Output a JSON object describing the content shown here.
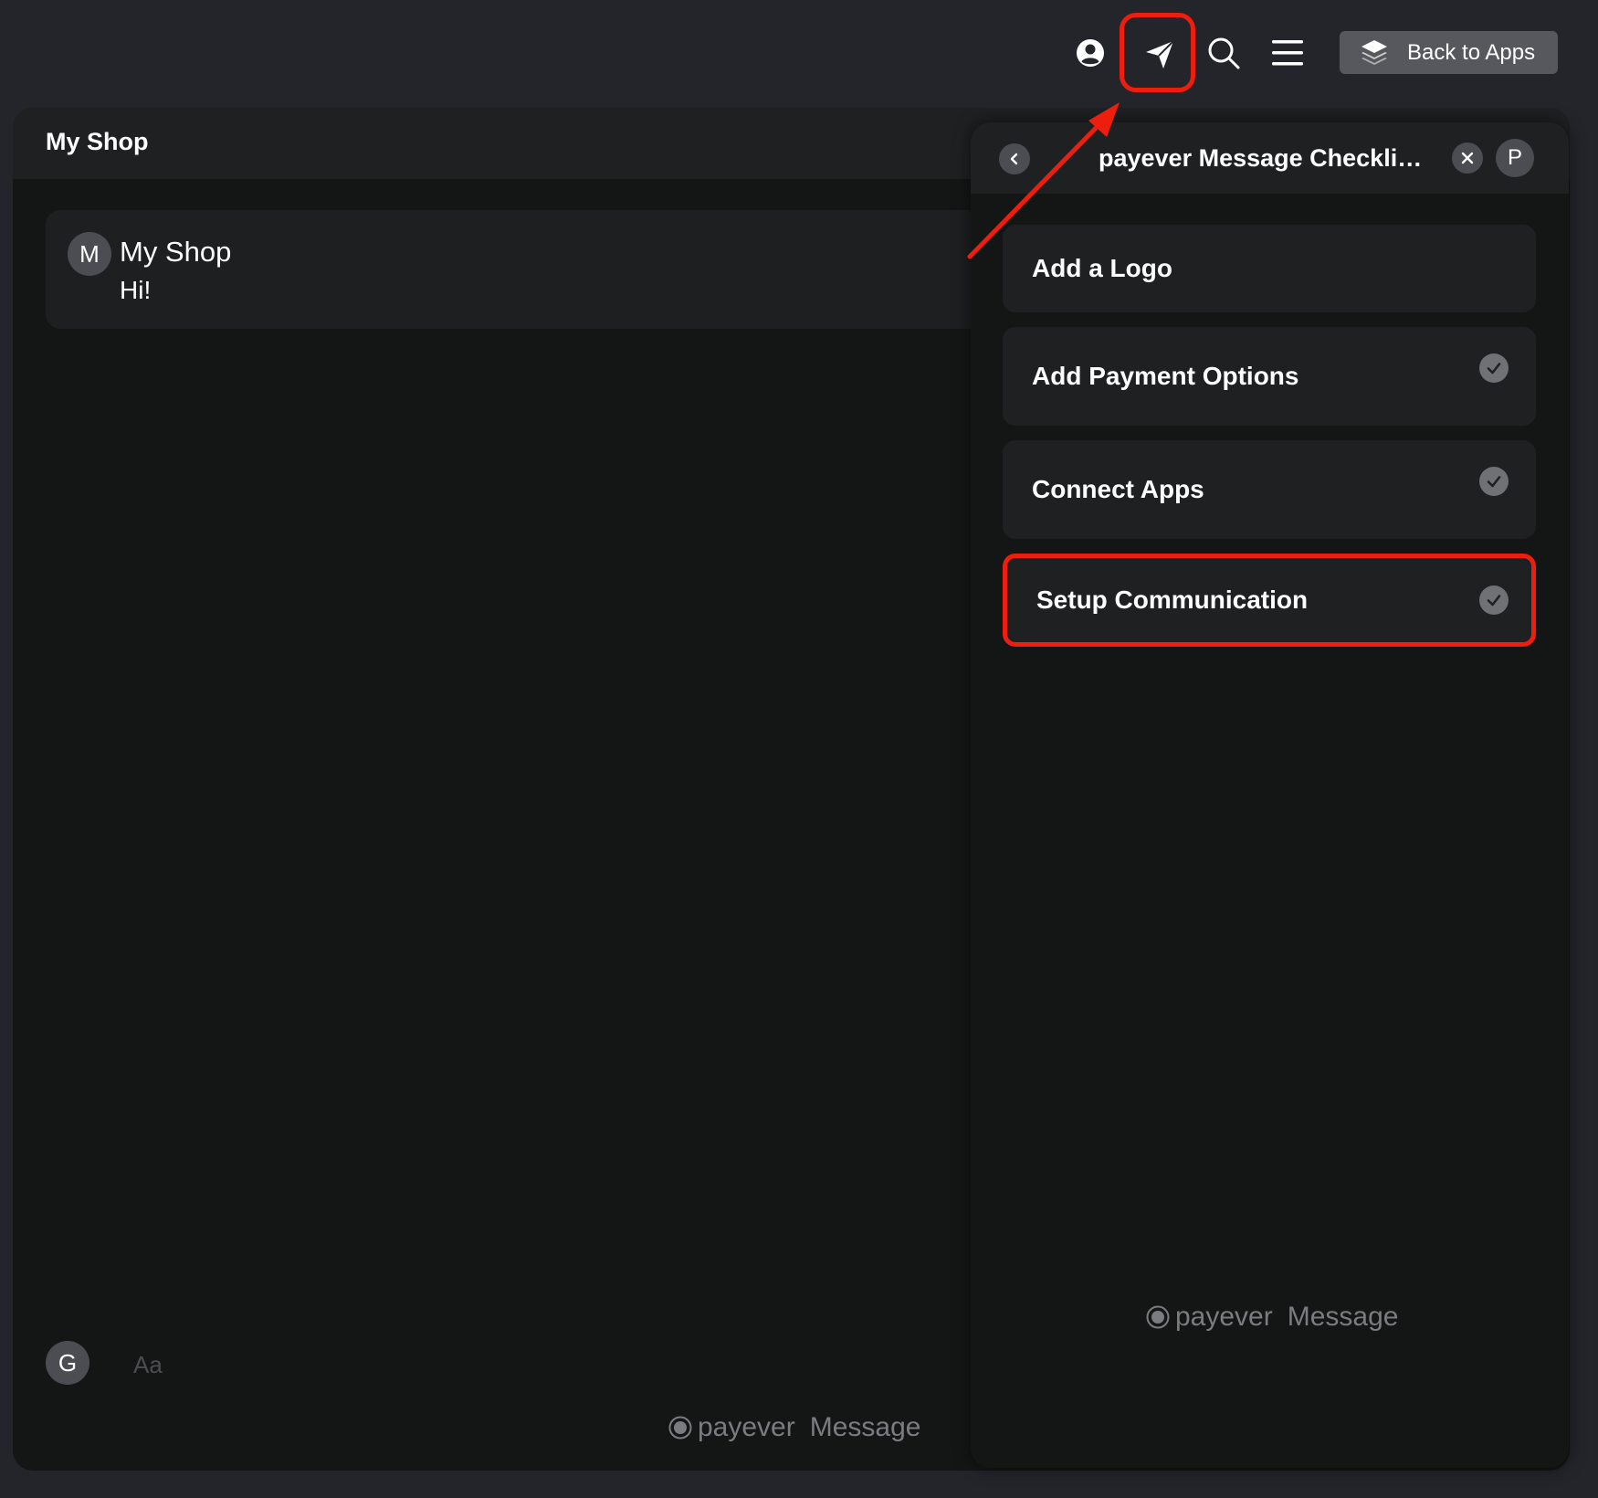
{
  "topbar": {
    "icons": [
      "user-circle-icon",
      "send-icon",
      "search-icon",
      "menu-icon"
    ],
    "back_button": {
      "label": "Back to Apps",
      "icon": "layers-icon"
    }
  },
  "main": {
    "title": "My Shop",
    "chat": {
      "avatar_letter": "M",
      "name": "My Shop",
      "message": "Hi!"
    },
    "composer": {
      "avatar_letter": "G",
      "placeholder": "Aa"
    },
    "brand": {
      "name": "payever",
      "product": "Message"
    }
  },
  "panel": {
    "title": "payever Message Checklis...",
    "avatar_letter": "P",
    "items": [
      {
        "label": "Add a Logo",
        "checked": false
      },
      {
        "label": "Add Payment Options",
        "checked": true
      },
      {
        "label": "Connect Apps",
        "checked": true
      },
      {
        "label": "Setup Communication",
        "checked": true,
        "highlighted": true
      }
    ],
    "brand": {
      "name": "payever",
      "product": "Message"
    }
  },
  "colors": {
    "background": "#23252b",
    "panel": "#141616",
    "card": "#1f2022",
    "button": "#56585e",
    "highlight": "#ee1e0e"
  }
}
